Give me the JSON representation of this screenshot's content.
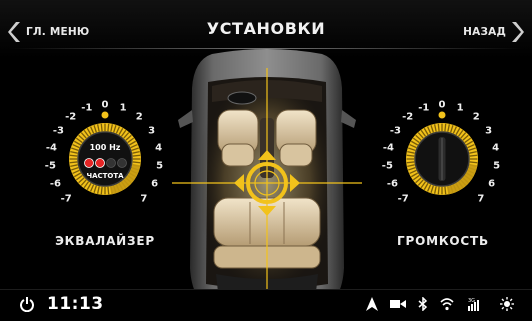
{
  "header": {
    "back_main_label": "ГЛ. МЕНЮ",
    "title": "УСТАНОВКИ",
    "back_label": "НАЗАД"
  },
  "equalizer": {
    "caption": "ЭКВАЛАЙЗЕР",
    "frequency": "100 Hz",
    "frequency_label": "ЧАСТОТА",
    "scale_labels": [
      "-7",
      "-6",
      "-5",
      "-4",
      "-3",
      "-2",
      "-1",
      "0",
      "1",
      "2",
      "3",
      "4",
      "5",
      "6",
      "7"
    ],
    "selected_value": "0",
    "frequency_dots": [
      "red",
      "red",
      "dark",
      "dark"
    ]
  },
  "volume": {
    "caption": "ГРОМКОСТЬ",
    "scale_labels": [
      "-7",
      "-6",
      "-5",
      "-4",
      "-3",
      "-2",
      "-1",
      "0",
      "1",
      "2",
      "3",
      "4",
      "5",
      "6",
      "7"
    ],
    "selected_value": "0"
  },
  "car": {
    "balance_fader": {
      "horizontal": "center",
      "vertical": "center"
    }
  },
  "status": {
    "time": "11:13",
    "icons": [
      "power-icon",
      "navigation-arrow-icon",
      "video-icon",
      "bluetooth-icon",
      "wifi-icon",
      "3g-signal-icon",
      "brightness-icon"
    ],
    "network_label": "3G"
  },
  "colors": {
    "accent": "#f2c21b",
    "accent_dark": "#c79a12",
    "background": "#000000",
    "indicator_red": "#e52525"
  }
}
